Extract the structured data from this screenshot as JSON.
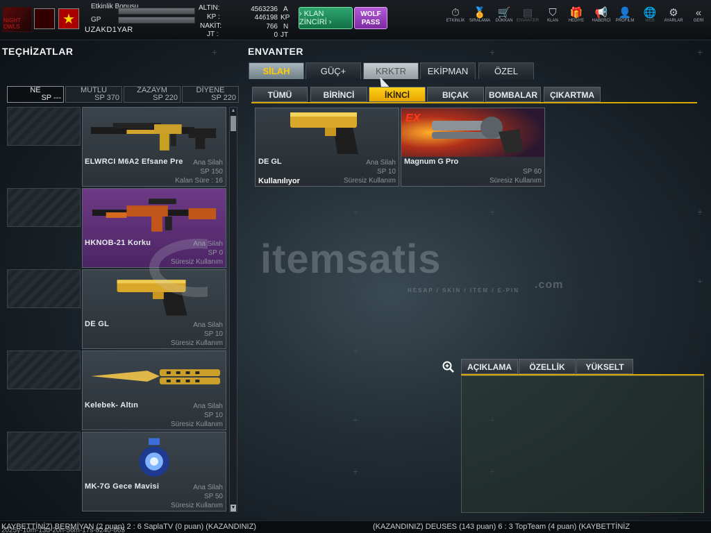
{
  "header": {
    "event_bonus_label": "Etkinlik Bonusu",
    "gp_label": "GP",
    "username": "UZAKD1YAR",
    "currencies": [
      {
        "label": "ALTIN:",
        "value": "4563236",
        "unit": "A"
      },
      {
        "label": "KP :",
        "value": "446198",
        "unit": "KP"
      },
      {
        "label": "NAKİT:",
        "value": "766",
        "unit": "N"
      },
      {
        "label": "JT :",
        "value": "0",
        "unit": "JT"
      }
    ],
    "klan_button": "› KLAN ZİNCİRİ ›",
    "wolf_button": "WOLF PASS",
    "nav": [
      {
        "label": "ETKİNLİK",
        "icon": "stopwatch-icon",
        "glyph": "⏱"
      },
      {
        "label": "SIRALAMA",
        "icon": "medal-icon",
        "glyph": "🏅"
      },
      {
        "label": "DÜKKAN",
        "icon": "cart-icon",
        "glyph": "🛒"
      },
      {
        "label": "ENVANTER",
        "icon": "inventory-icon",
        "glyph": "▤"
      },
      {
        "label": "KLAN",
        "icon": "shield-icon",
        "glyph": "⛉"
      },
      {
        "label": "HEDİYE",
        "icon": "gift-icon",
        "glyph": "🎁"
      },
      {
        "label": "HABERCİ",
        "icon": "megaphone-icon",
        "glyph": "📢"
      },
      {
        "label": "PROFİLM",
        "icon": "profile-icon",
        "glyph": "👤"
      },
      {
        "label": "WEB",
        "icon": "globe-icon",
        "glyph": "🌐"
      },
      {
        "label": "AYARLAR",
        "icon": "gear-icon",
        "glyph": "⚙"
      },
      {
        "label": "GERİ",
        "icon": "back-icon",
        "glyph": "«"
      }
    ],
    "logo_text": "NIGHT OWLS"
  },
  "left": {
    "title": "TEÇHİZATLAR",
    "modes": [
      {
        "name": "NE",
        "sp": "SP ---"
      },
      {
        "name": "MUTLU",
        "sp": "SP 370"
      },
      {
        "name": "ZAZAYM",
        "sp": "SP 220"
      },
      {
        "name": "DİYENE",
        "sp": "SP 220"
      }
    ],
    "items": [
      {
        "name": "ELWRCI M6A2 Efsane Pre",
        "r1": "Ana Silah",
        "r2": "SP 150",
        "r3": "Kalan Süre : 16"
      },
      {
        "name": "HKNOB-21 Korku",
        "r1": "Ana Silah",
        "r2": "SP 0",
        "r3": "Süresiz Kullanım"
      },
      {
        "name": "DE GL",
        "r1": "Ana Silah",
        "r2": "SP 10",
        "r3": "Süresiz Kullanım"
      },
      {
        "name": "Kelebek- Altın",
        "r1": "Ana Silah",
        "r2": "SP 10",
        "r3": "Süresiz Kullanım"
      },
      {
        "name": "MK-7G Gece Mavisi",
        "r1": "Ana Silah",
        "r2": "SP 50",
        "r3": "Süresiz Kullanım"
      }
    ]
  },
  "inventory": {
    "title": "ENVANTER",
    "tabs": [
      "SİLAH",
      "GÜÇ+",
      "KRKTR",
      "EKİPMAN",
      "ÖZEL"
    ],
    "subtabs": [
      "TÜMÜ",
      "BİRİNCİ",
      "İKİNCİ",
      "BIÇAK",
      "BOMBALAR",
      "ÇIKARTMA"
    ],
    "items": [
      {
        "name": "DE GL",
        "r1": "Ana Silah",
        "r2": "SP 10",
        "r3": "Süresiz Kullanım",
        "status": "Kullanılıyor"
      },
      {
        "name": "Magnum G Pro",
        "badge": "EX",
        "r2": "SP 60",
        "r3": "Süresiz Kullanım"
      }
    ],
    "detail_tabs": [
      "AÇIKLAMA",
      "ÖZELLİK",
      "YÜKSELT"
    ]
  },
  "watermark": {
    "text": "itemsatis",
    "sub": "HESAP / SKIN / ITEM / E-PIN",
    "com": ".com"
  },
  "ticker": {
    "left": "KAYBETTİNİZ) BERMİYAN (2 puan) 2 : 6 SaplaTV (0 puan) (KAZANDINIZ)",
    "right": "(KAZANDINIZ) DEUSES (143 puan) 6 : 3 TopTeam (4 puan) (KAYBETTİNİZ",
    "version": "2025y-10m-13d-20h-56m-17s-0240-665"
  },
  "colors": {
    "accent": "#ffcc00",
    "klan": "#1f8a5a",
    "wolf": "#9a3dc4",
    "rare": "#5c2d75"
  }
}
